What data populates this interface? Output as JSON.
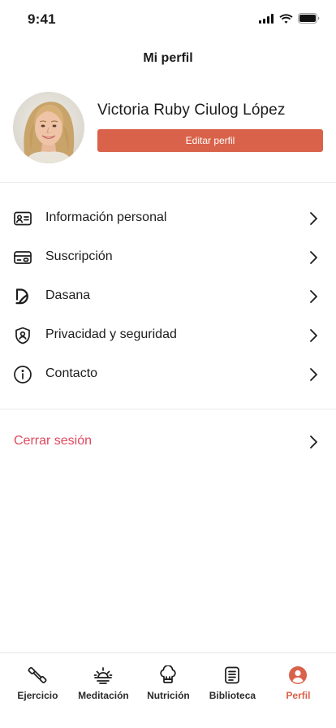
{
  "status_bar": {
    "time": "9:41"
  },
  "header": {
    "title": "Mi perfil"
  },
  "profile": {
    "name": "Victoria Ruby Ciulog López",
    "edit_label": "Editar perfil"
  },
  "menu": {
    "items": [
      {
        "label": "Información personal",
        "icon": "id-card-icon"
      },
      {
        "label": "Suscripción",
        "icon": "credit-card-icon"
      },
      {
        "label": "Dasana",
        "icon": "dasana-logo-icon"
      },
      {
        "label": "Privacidad y seguridad",
        "icon": "shield-user-icon"
      },
      {
        "label": "Contacto",
        "icon": "info-icon"
      }
    ],
    "logout_label": "Cerrar sesión"
  },
  "tabbar": {
    "active": "Perfil",
    "items": [
      {
        "label": "Ejercicio",
        "icon": "dumbbell-icon"
      },
      {
        "label": "Meditación",
        "icon": "sunrise-icon"
      },
      {
        "label": "Nutrición",
        "icon": "chef-hat-icon"
      },
      {
        "label": "Biblioteca",
        "icon": "notebook-icon"
      },
      {
        "label": "Perfil",
        "icon": "user-circle-icon"
      }
    ]
  },
  "colors": {
    "accent": "#d9624a",
    "logout": "#e0485e",
    "text": "#1c1c1c"
  }
}
